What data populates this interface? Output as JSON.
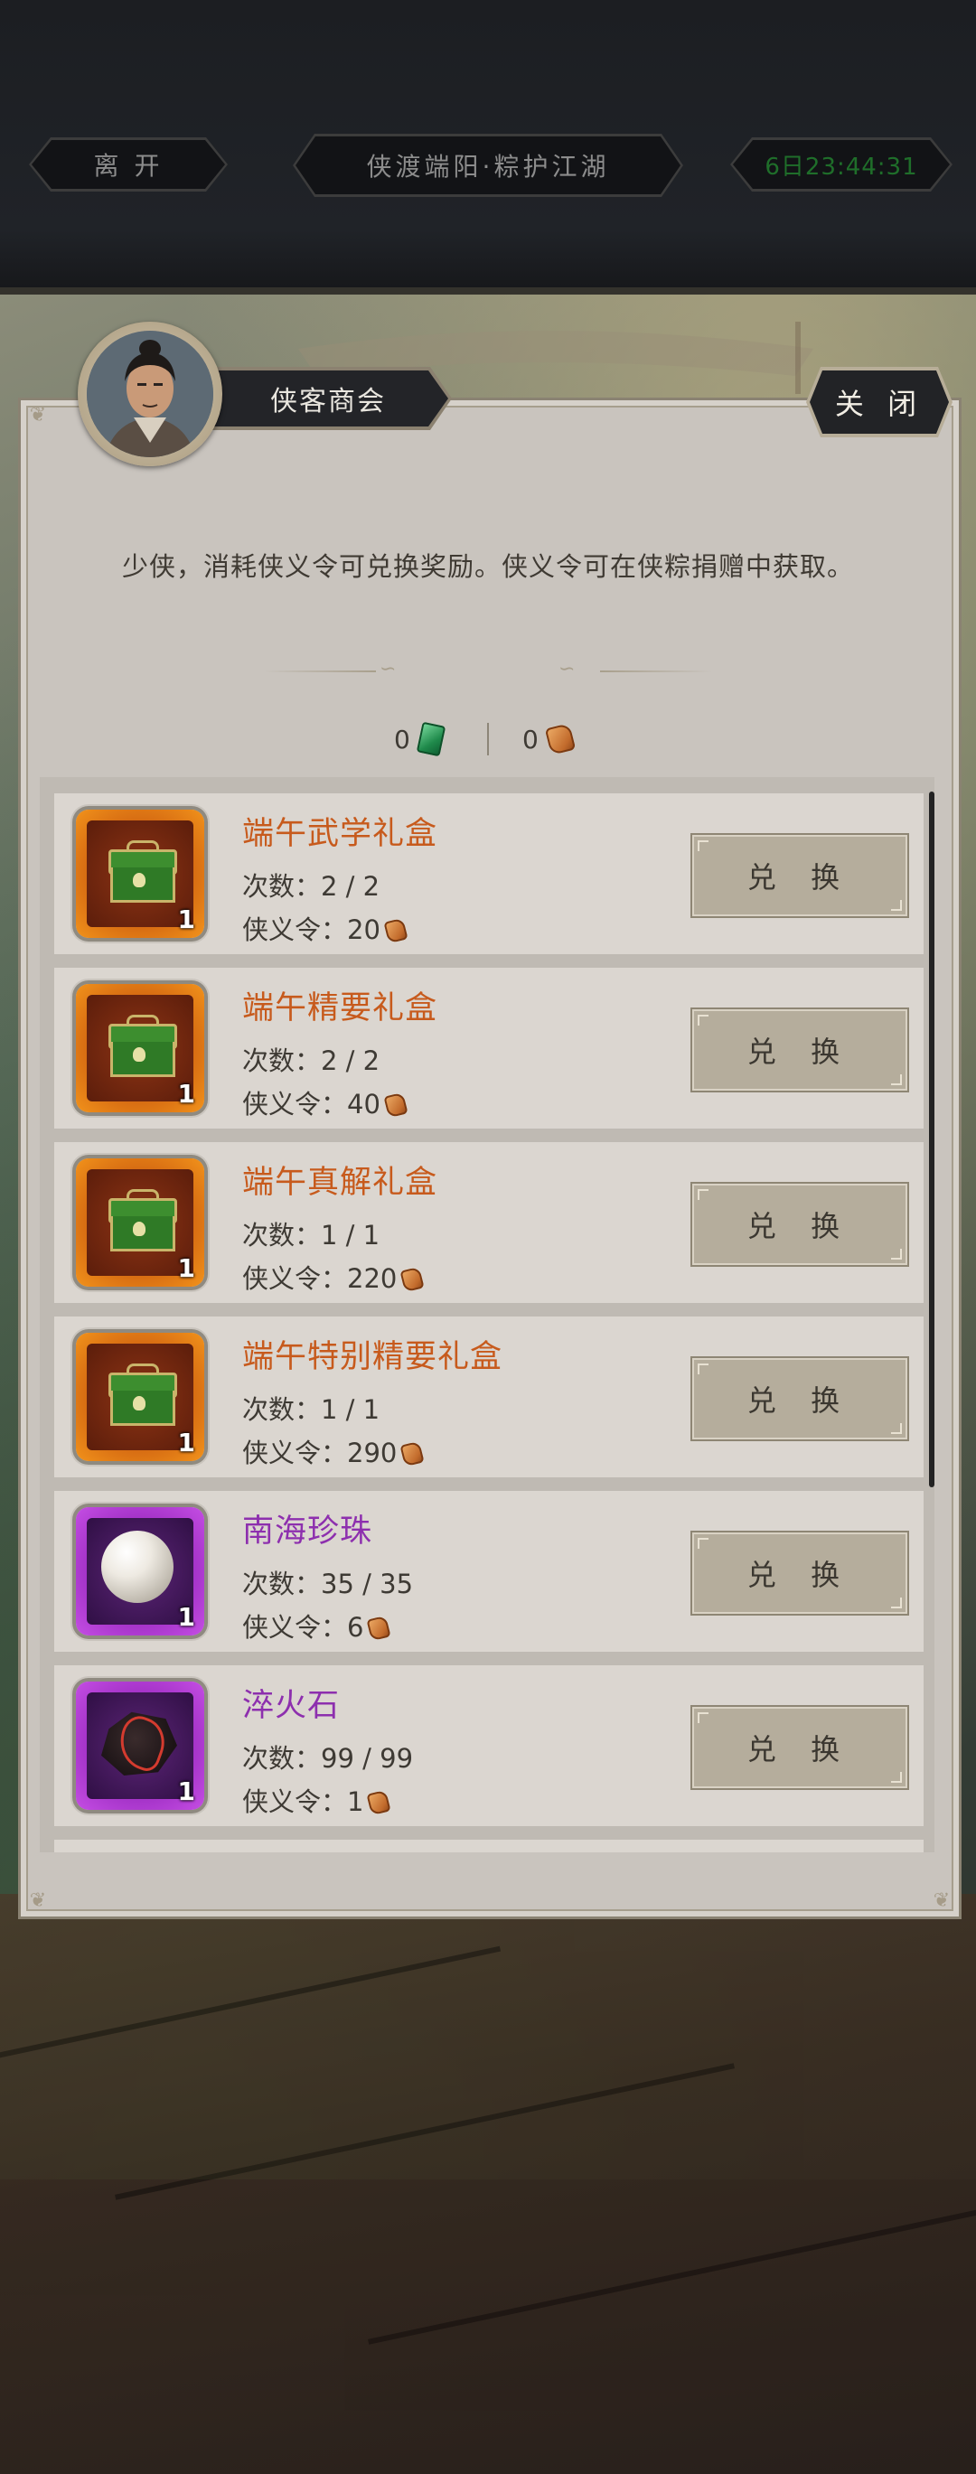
{
  "topbar": {
    "leave_label": "离 开",
    "event_title": "侠渡端阳·粽护江湖",
    "timer": "6日23:44:31"
  },
  "panel": {
    "title": "侠客商会",
    "close_label": "关 闭",
    "description": "少侠，消耗侠义令可兑换奖励。侠义令可在侠粽捐赠中获取。",
    "currencies": [
      {
        "amount": "0",
        "icon": "jade-token-icon"
      },
      {
        "amount": "0",
        "icon": "xiayi-token-icon"
      }
    ]
  },
  "items": [
    {
      "name": "端午武学礼盒",
      "rarity": "orange",
      "icon": "gift-chest-icon",
      "count": "1",
      "times_label": "次数：",
      "times": "2 / 2",
      "cost_label": "侠义令：",
      "cost": "20",
      "button": "兑 换"
    },
    {
      "name": "端午精要礼盒",
      "rarity": "orange",
      "icon": "gift-chest-icon",
      "count": "1",
      "times_label": "次数：",
      "times": "2 / 2",
      "cost_label": "侠义令：",
      "cost": "40",
      "button": "兑 换"
    },
    {
      "name": "端午真解礼盒",
      "rarity": "orange",
      "icon": "gift-chest-icon",
      "count": "1",
      "times_label": "次数：",
      "times": "1 / 1",
      "cost_label": "侠义令：",
      "cost": "220",
      "button": "兑 换"
    },
    {
      "name": "端午特别精要礼盒",
      "rarity": "orange",
      "icon": "gift-chest-icon",
      "count": "1",
      "times_label": "次数：",
      "times": "1 / 1",
      "cost_label": "侠义令：",
      "cost": "290",
      "button": "兑 换"
    },
    {
      "name": "南海珍珠",
      "rarity": "purple",
      "icon": "pearl-icon",
      "count": "1",
      "times_label": "次数：",
      "times": "35 / 35",
      "cost_label": "侠义令：",
      "cost": "6",
      "button": "兑 换"
    },
    {
      "name": "淬火石",
      "rarity": "purple",
      "icon": "quench-stone-icon",
      "count": "1",
      "times_label": "次数：",
      "times": "99 / 99",
      "cost_label": "侠义令：",
      "cost": "1",
      "button": "兑 换"
    }
  ],
  "colors": {
    "orange_name": "#c75a1c",
    "purple_name": "#8d2fae",
    "timer_green": "#1f6e2a",
    "panel_bg": "#c9c4be"
  }
}
